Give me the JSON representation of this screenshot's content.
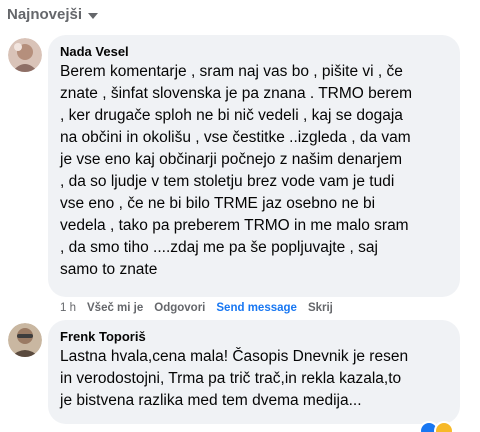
{
  "sort": {
    "label": "Najnovejši"
  },
  "comments": [
    {
      "author": "Nada Vesel",
      "lines": [
        "Berem komentarje , sram naj vas bo , pišite vi , če",
        "znate , šinfat slovenska je pa znana . TRMO berem",
        ", ker drugače sploh ne bi nič vedeli , kaj se dogaja",
        "na občini in okolišu , vse čestitke ..izgleda , da vam",
        "je vse eno kaj občinarji počnejo z našim denarjem",
        ", da so ljudje v tem stoletju brez vode vam je tudi",
        "vse eno , če ne bi bilo TRME jaz osebno ne bi",
        "vedela , tako pa preberem TRMO in me malo sram",
        ", da smo tiho ....zdaj me pa še popljuvajte , saj",
        "samo to znate"
      ],
      "actions": {
        "time": "1 h",
        "like": "Všeč mi je",
        "reply": "Odgovori",
        "send": "Send message",
        "hide": "Skrij"
      }
    },
    {
      "author": "Frenk Toporiš",
      "lines": [
        "Lastna hvala,cena mala! Časopis Dnevnik je resen",
        "in verodostojni, Trma pa trič trač,in rekla kazala,to",
        "je bistvena razlika med tem dvema medija..."
      ]
    }
  ],
  "colors": {
    "bubble": "#f0f2f5",
    "secondary_text": "#65676b",
    "link_blue": "#1877f2"
  }
}
